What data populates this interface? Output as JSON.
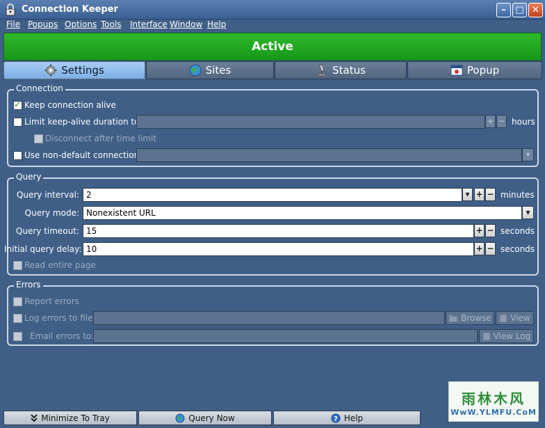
{
  "window": {
    "title": "Connection Keeper"
  },
  "menu": [
    "File",
    "Popups",
    "Options",
    "Tools",
    "Interface",
    "Window",
    "Help"
  ],
  "status_banner": "Active",
  "tabs": [
    {
      "label": "Settings",
      "icon": "gear-icon",
      "active": true
    },
    {
      "label": "Sites",
      "icon": "globe-icon",
      "active": false
    },
    {
      "label": "Status",
      "icon": "microscope-icon",
      "active": false
    },
    {
      "label": "Popup",
      "icon": "popup-window-icon",
      "active": false
    }
  ],
  "connection": {
    "legend": "Connection",
    "keep_alive": "Keep connection alive",
    "limit_duration": "Limit keep-alive duration to:",
    "hours_unit": "hours",
    "disconnect_after": "Disconnect after time limit",
    "non_default": "Use non-default connection:",
    "limit_duration_value": "",
    "non_default_value": ""
  },
  "query": {
    "legend": "Query",
    "interval_label": "Query interval:",
    "interval_value": "2",
    "interval_unit": "minutes",
    "mode_label": "Query mode:",
    "mode_value": "Nonexistent URL",
    "timeout_label": "Query timeout:",
    "timeout_value": "15",
    "timeout_unit": "seconds",
    "delay_label": "Initial query delay:",
    "delay_value": "10",
    "delay_unit": "seconds",
    "read_entire": "Read entire page"
  },
  "errors": {
    "legend": "Errors",
    "report": "Report errors",
    "log_to_file": "Log errors to file:",
    "browse": "Browse",
    "view": "View",
    "email_to": "Email errors to:",
    "view_log": "View Log",
    "log_file_value": "",
    "email_value": ""
  },
  "bottom_buttons": {
    "minimize": "Minimize To Tray",
    "query_now": "Query Now",
    "help": "Help"
  },
  "spin": {
    "plus": "+",
    "minus": "−",
    "dropdown": "▾"
  },
  "watermark": {
    "line1": "雨林木风",
    "line2": "WwW.YLMFU.CoM"
  },
  "colors": {
    "banner_green": "#1fa81f",
    "window_bg": "#3f5f86"
  }
}
